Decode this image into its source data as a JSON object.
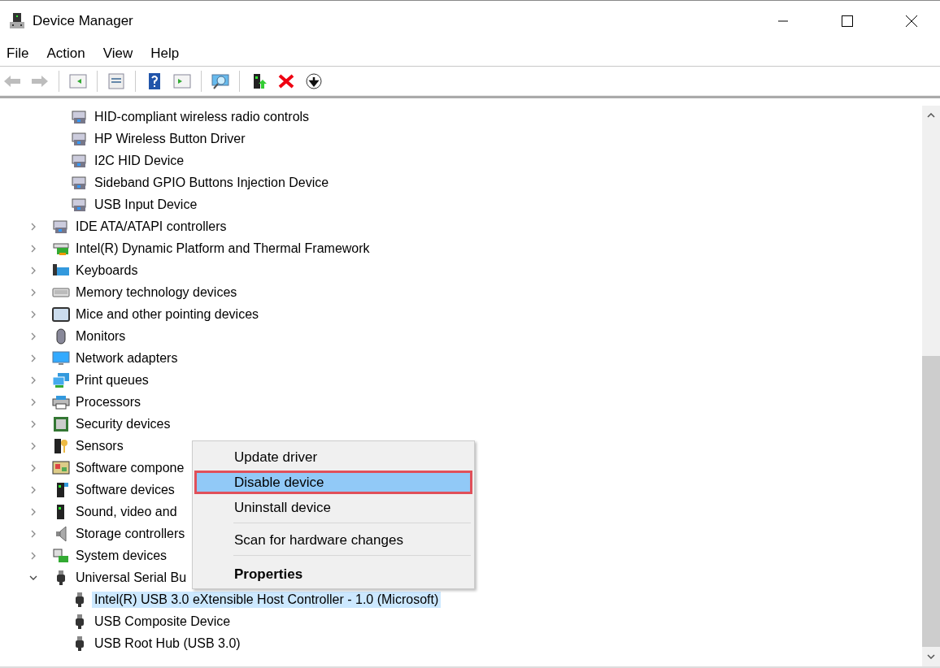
{
  "window": {
    "title": "Device Manager"
  },
  "menu_bar": [
    "File",
    "Action",
    "View",
    "Help"
  ],
  "toolbar": [
    {
      "kind": "back",
      "disabled": true
    },
    {
      "kind": "forward",
      "disabled": true
    },
    {
      "kind": "sep"
    },
    {
      "kind": "tree"
    },
    {
      "kind": "sep"
    },
    {
      "kind": "props"
    },
    {
      "kind": "sep"
    },
    {
      "kind": "help"
    },
    {
      "kind": "pane"
    },
    {
      "kind": "sep"
    },
    {
      "kind": "scan"
    },
    {
      "kind": "sep"
    },
    {
      "kind": "update"
    },
    {
      "kind": "remove"
    },
    {
      "kind": "down"
    }
  ],
  "tree": [
    {
      "expanded": true,
      "children": [
        {
          "label": "HID-compliant wireless radio controls",
          "selected": false
        },
        {
          "label": "HP Wireless Button Driver",
          "selected": false
        },
        {
          "label": "I2C HID Device",
          "selected": false
        },
        {
          "label": "Sideband GPIO Buttons Injection Device",
          "selected": false
        },
        {
          "label": "USB Input Device",
          "selected": false
        }
      ]
    },
    {
      "label": "IDE ATA/ATAPI controllers",
      "expanded": false
    },
    {
      "label": "Intel(R) Dynamic Platform and Thermal Framework",
      "expanded": false
    },
    {
      "label": "Keyboards",
      "expanded": false
    },
    {
      "label": "Memory technology devices",
      "expanded": false
    },
    {
      "label": "Mice and other pointing devices",
      "expanded": false
    },
    {
      "label": "Monitors",
      "expanded": false
    },
    {
      "label": "Network adapters",
      "expanded": false
    },
    {
      "label": "Print queues",
      "expanded": false
    },
    {
      "label": "Processors",
      "expanded": false
    },
    {
      "label": "Security devices",
      "expanded": false
    },
    {
      "label": "Sensors",
      "expanded": false
    },
    {
      "label": "Software compone",
      "expanded": false
    },
    {
      "label": "Software devices",
      "expanded": false
    },
    {
      "label": "Sound, video and",
      "expanded": false
    },
    {
      "label": "Storage controllers",
      "expanded": false
    },
    {
      "label": "System devices",
      "expanded": false
    },
    {
      "label": "Universal Serial Bu",
      "expanded": true,
      "children": [
        {
          "label": "Intel(R) USB 3.0 eXtensible Host Controller - 1.0 (Microsoft)",
          "selected": true
        },
        {
          "label": "USB Composite Device",
          "selected": false
        },
        {
          "label": "USB Root Hub (USB 3.0)",
          "selected": false
        }
      ]
    }
  ],
  "context_menu": {
    "items": [
      {
        "kind": "item",
        "label": "Update driver",
        "selected": false
      },
      {
        "kind": "item",
        "label": "Disable device",
        "selected": true
      },
      {
        "kind": "item",
        "label": "Uninstall device",
        "selected": false
      },
      {
        "kind": "separator"
      },
      {
        "kind": "item",
        "label": "Scan for hardware changes",
        "selected": false
      },
      {
        "kind": "separator"
      },
      {
        "kind": "default",
        "label": "Properties",
        "selected": false
      }
    ]
  }
}
